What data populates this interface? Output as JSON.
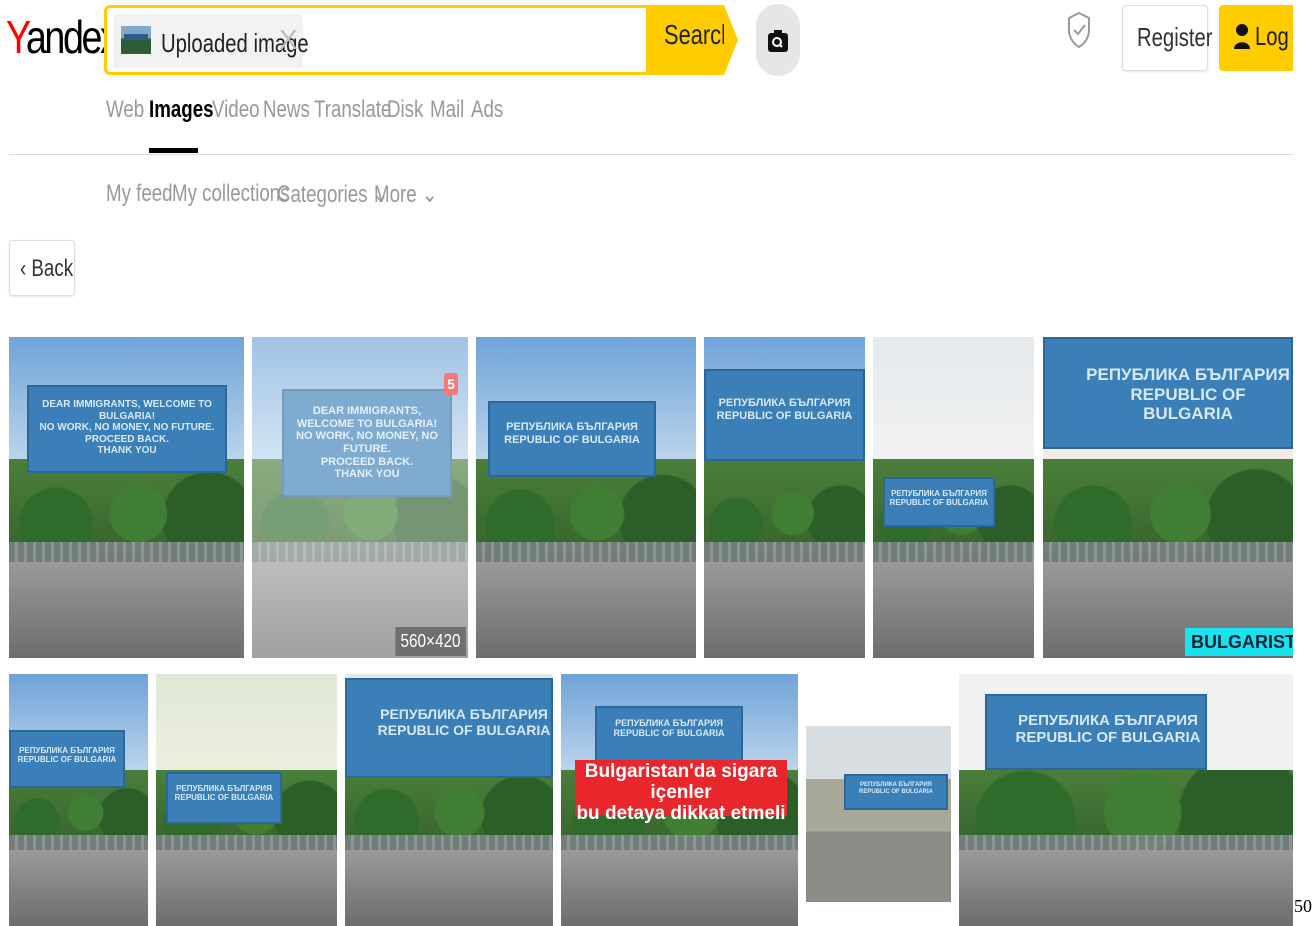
{
  "header": {
    "logo": {
      "first": "Y",
      "rest": "andex"
    },
    "chip_label": "Uploaded image",
    "chip_close": "X",
    "search_label": "Search",
    "register_label": "Register",
    "login_label": "Log in"
  },
  "nav": {
    "tabs": [
      "Web",
      "Images",
      "Video",
      "News",
      "Translate",
      "Disk",
      "Mail",
      "Ads"
    ],
    "active": "Images"
  },
  "subnav": [
    "My feed",
    "My collections",
    "Categories ⌄",
    "More ⌄"
  ],
  "back_label": "‹ Back",
  "results": {
    "row1": [
      {
        "sign": "DEAR IMMIGRANTS, WELCOME TO BULGARIA!\nNO WORK, NO MONEY, NO FUTURE.\nPROCEED BACK.\nTHANK YOU"
      },
      {
        "sign": "DEAR IMMIGRANTS, WELCOME TO BULGARIA!\nNO WORK, NO MONEY, NO FUTURE.\nPROCEED BACK.\nTHANK YOU",
        "badge_top": "5",
        "size": "560×420"
      },
      {
        "sign": "РЕПУБЛИКА БЪЛГАРИЯ\nREPUBLIC OF BULGARIA"
      },
      {
        "sign": "РЕПУБЛИКА БЪЛГАРИЯ\nREPUBLIC OF BULGARIA"
      },
      {
        "sign": "РЕПУБЛИКА БЪЛГАРИЯ\nREPUBLIC OF BULGARIA"
      },
      {
        "sign": "РЕПУБЛИКА БЪЛГАРИЯ\nREPUBLIC OF BULGARIA",
        "caption": "BULGARISTAN"
      }
    ],
    "row2": [
      {
        "sign": "РЕПУБЛИКА БЪЛГАРИЯ\nREPUBLIC OF BULGARIA"
      },
      {
        "sign": "РЕПУБЛИКА БЪЛГАРИЯ\nREPUBLIC OF BULGARIA"
      },
      {
        "sign": "РЕПУБЛИКА БЪЛГАРИЯ\nREPUBLIC OF BULGARIA"
      },
      {
        "sign": "РЕПУБЛИКА БЪЛГАРИЯ\nREPUBLIC OF BULGARIA",
        "overlay": "Bulgaristan'da sigara içenler\nbu detaya dikkat etmeli"
      },
      {
        "sign": "РЕПУБЛИКА БЪЛГАРИЯ\nREPUBLIC OF BULGARIA"
      },
      {
        "sign": "РЕПУБЛИКА БЪЛГАРИЯ\nREPUBLIC OF BULGARIA"
      }
    ]
  },
  "page_number": "50",
  "colors": {
    "accent": "#ffcc00",
    "logo_red": "#ff0000",
    "sign_blue": "#3b7fb8",
    "overlay_red": "#e8262b",
    "caption_cyan": "#17e3f0"
  },
  "icons": [
    "camera-search-icon",
    "shield-check-icon",
    "user-icon",
    "close-icon",
    "chevron-left-icon"
  ]
}
